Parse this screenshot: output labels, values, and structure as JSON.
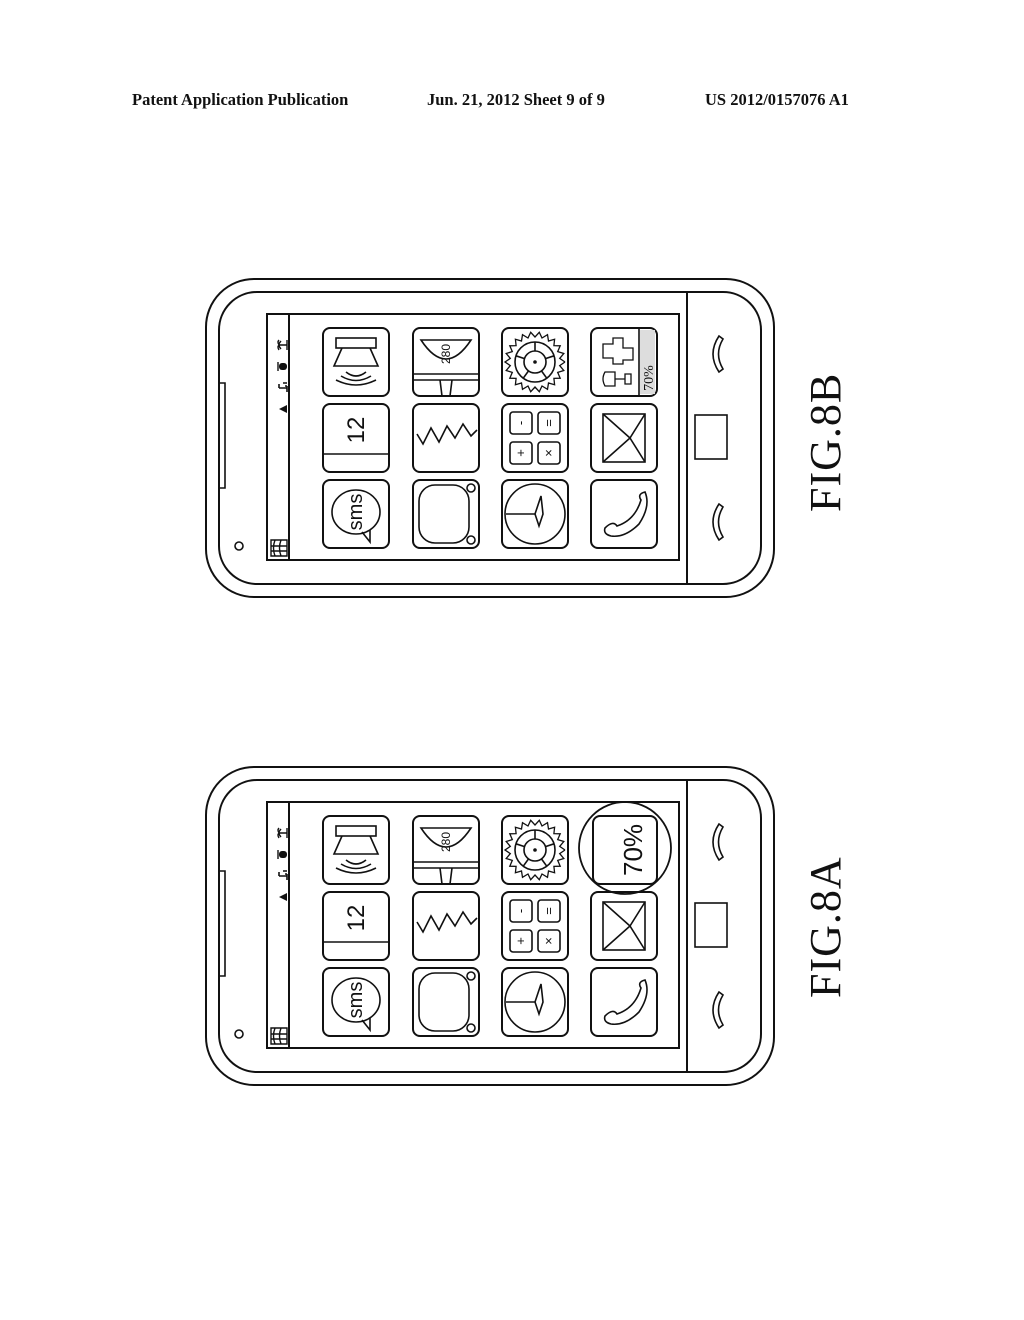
{
  "header": {
    "publication": "Patent Application Publication",
    "date_sheet": "Jun. 21, 2012   Sheet 9 of 9",
    "patent_number": "US 2012/0157076 A1"
  },
  "figures": [
    {
      "id": "fig8b",
      "label": "FIG.8B",
      "highlight_circle": false,
      "battery_widget_expanded": true,
      "battery_text": "70%",
      "calendar_text": "12",
      "sms_text": "sms",
      "speedometer_text": "280"
    },
    {
      "id": "fig8a",
      "label": "FIG.8A",
      "highlight_circle": true,
      "battery_widget_expanded": false,
      "battery_text": "70%",
      "calendar_text": "12",
      "sms_text": "sms",
      "speedometer_text": "280"
    }
  ],
  "status_bar": {
    "icons": [
      "wifi-triangle-icon",
      "signal-strength-icon",
      "headset-icon",
      "alarm-bell-icon"
    ],
    "bottom_icon": "book-icon"
  },
  "app_grid": {
    "rows": [
      [
        "speaker-icon",
        "speedometer-icon",
        "settings-gear-icon",
        "battery-widget"
      ],
      [
        "calendar-icon",
        "graph-icon",
        "calculator-icon",
        "mail-envelope-icon"
      ],
      [
        "sms-bubble-icon",
        "tv-screen-icon",
        "clock-icon",
        "phone-handset-icon"
      ]
    ],
    "calculator_keys": [
      "-",
      "=",
      "+",
      "×"
    ]
  },
  "hardware": {
    "left_keys": [
      "call-key-icon",
      "end-key-icon"
    ],
    "home_button": "home-button",
    "camera": "camera-dot"
  }
}
